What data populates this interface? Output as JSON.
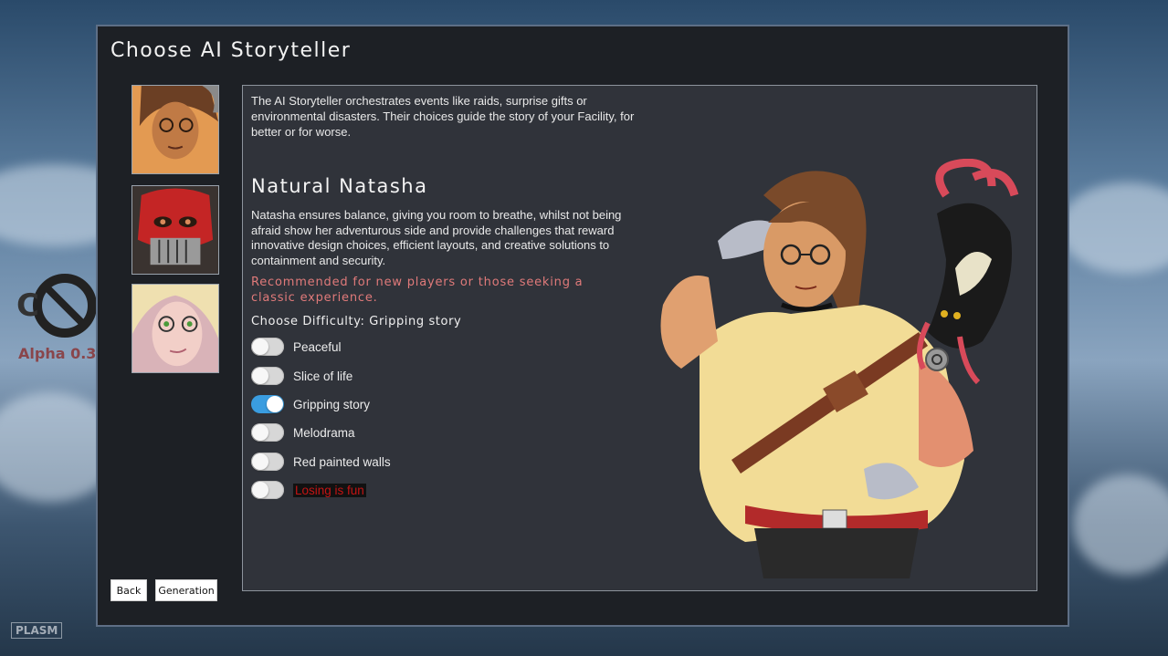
{
  "background": {
    "alpha_text": "Alpha 0.3",
    "logo_text": "PLASM"
  },
  "dialog": {
    "title": "Choose AI Storyteller",
    "intro": "The AI Storyteller orchestrates events like raids, surprise gifts or environmental disasters. Their choices guide the story of your Facility, for better or for worse.",
    "storyteller": {
      "name": "Natural Natasha",
      "description": "Natasha ensures balance, giving you room to breathe, whilst not being afraid show her adventurous side and provide challenges that reward innovative design choices, efficient layouts, and creative solutions to containment and security.",
      "recommendation": "Recommended for new players or those seeking a classic experience."
    },
    "difficulty": {
      "heading": "Choose Difficulty: Gripping story",
      "options": [
        {
          "label": "Peaceful",
          "selected": false
        },
        {
          "label": "Slice of life",
          "selected": false
        },
        {
          "label": "Gripping story",
          "selected": true
        },
        {
          "label": "Melodrama",
          "selected": false
        },
        {
          "label": "Red painted walls",
          "selected": false
        },
        {
          "label": "Losing is fun",
          "selected": false
        }
      ]
    },
    "portraits": [
      "storyteller-natasha",
      "storyteller-masked",
      "storyteller-blonde"
    ],
    "buttons": {
      "back": "Back",
      "generation": "Generation"
    }
  },
  "colors": {
    "accent_toggle": "#3a9de0",
    "recommend_text": "#e07a7a",
    "danger_text": "#c41414",
    "panel_bg": "#30333a",
    "dialog_bg": "#1d2025"
  }
}
